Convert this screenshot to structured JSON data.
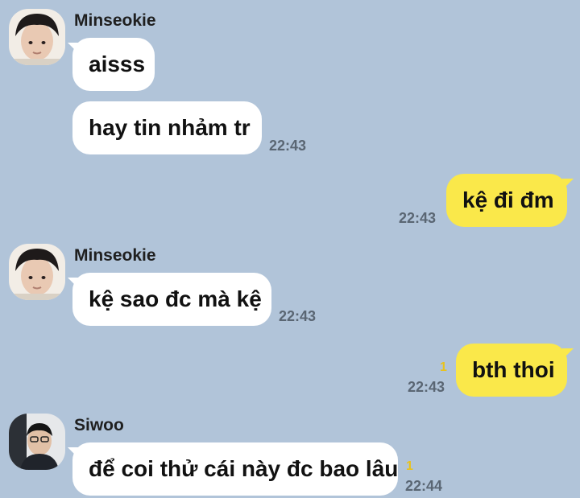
{
  "contacts": {
    "minseokie": {
      "name": "Minseokie",
      "avatar": "minseokie-avatar"
    },
    "siwoo": {
      "name": "Siwoo",
      "avatar": "siwoo-avatar"
    }
  },
  "messages": [
    {
      "sender": "Minseokie",
      "text": "aisss",
      "time": ""
    },
    {
      "sender": "Minseokie",
      "text": "hay tin nhảm tr",
      "time": "22:43"
    },
    {
      "sender": "me",
      "text": "kệ đi đm",
      "time": "22:43"
    },
    {
      "sender": "Minseokie",
      "text": "kệ sao đc mà kệ",
      "time": "22:43"
    },
    {
      "sender": "me",
      "text": "bth thoi",
      "time": "22:43",
      "unread": "1"
    },
    {
      "sender": "Siwoo",
      "text": "để coi thử cái này đc bao lâu",
      "time": "22:44",
      "unread": "1"
    }
  ],
  "colors": {
    "background": "#b1c4d9",
    "incoming_bubble": "#ffffff",
    "outgoing_bubble": "#fae84a",
    "unread_count": "#e8c21c",
    "timestamp": "#5a6673"
  }
}
